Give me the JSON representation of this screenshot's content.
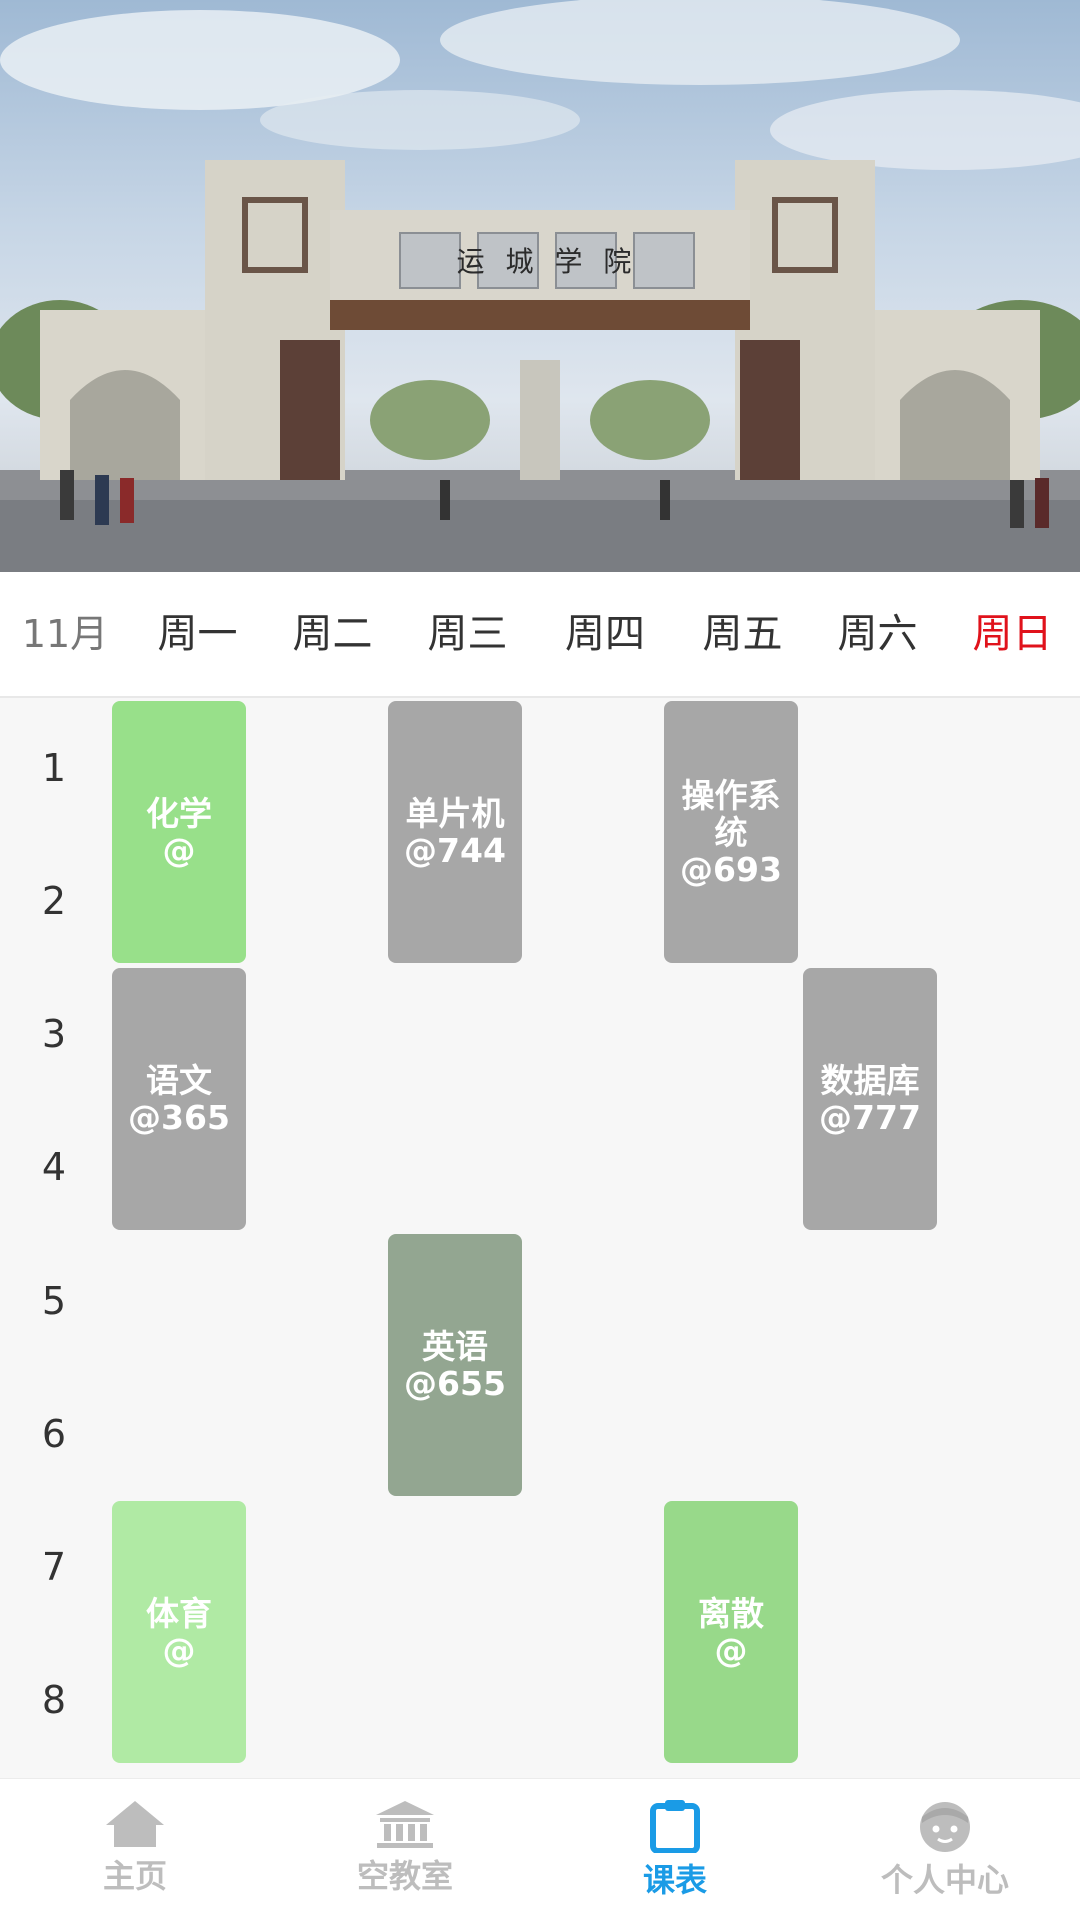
{
  "banner": {
    "gate_sign": "运 城 学 院"
  },
  "week_header": {
    "month": "11月",
    "days": [
      "周一",
      "周二",
      "周三",
      "周四",
      "周五",
      "周六",
      "周日"
    ],
    "today_index": 6,
    "today_color": "#e0121b"
  },
  "periods": [
    "1",
    "2",
    "3",
    "4",
    "5",
    "6",
    "7",
    "8"
  ],
  "courses": [
    {
      "name": "化学",
      "room": "@",
      "day": 1,
      "start": 1,
      "end": 2,
      "color": "#98e08a"
    },
    {
      "name": "单片机",
      "room": "@744",
      "day": 3,
      "start": 1,
      "end": 2,
      "color": "#a7a7a7"
    },
    {
      "name": "操作系统",
      "room": "@693",
      "day": 5,
      "start": 1,
      "end": 2,
      "color": "#a7a7a7"
    },
    {
      "name": "语文",
      "room": "@365",
      "day": 1,
      "start": 3,
      "end": 4,
      "color": "#a7a7a7"
    },
    {
      "name": "数据库",
      "room": "@777",
      "day": 6,
      "start": 3,
      "end": 4,
      "color": "#a7a7a7"
    },
    {
      "name": "英语",
      "room": "@655",
      "day": 3,
      "start": 5,
      "end": 6,
      "color": "#93a691"
    },
    {
      "name": "体育",
      "room": "@",
      "day": 1,
      "start": 7,
      "end": 8,
      "color": "#b0eaa4"
    },
    {
      "name": "离散",
      "room": "@",
      "day": 5,
      "start": 7,
      "end": 8,
      "color": "#98d98a"
    }
  ],
  "bottom_nav": {
    "items": [
      {
        "label": "主页",
        "icon": "home-icon"
      },
      {
        "label": "空教室",
        "icon": "building-icon"
      },
      {
        "label": "课表",
        "icon": "clipboard-icon"
      },
      {
        "label": "个人中心",
        "icon": "face-icon"
      }
    ],
    "active_index": 2,
    "active_color": "#1a9be6",
    "inactive_color": "#bdbdbd"
  }
}
